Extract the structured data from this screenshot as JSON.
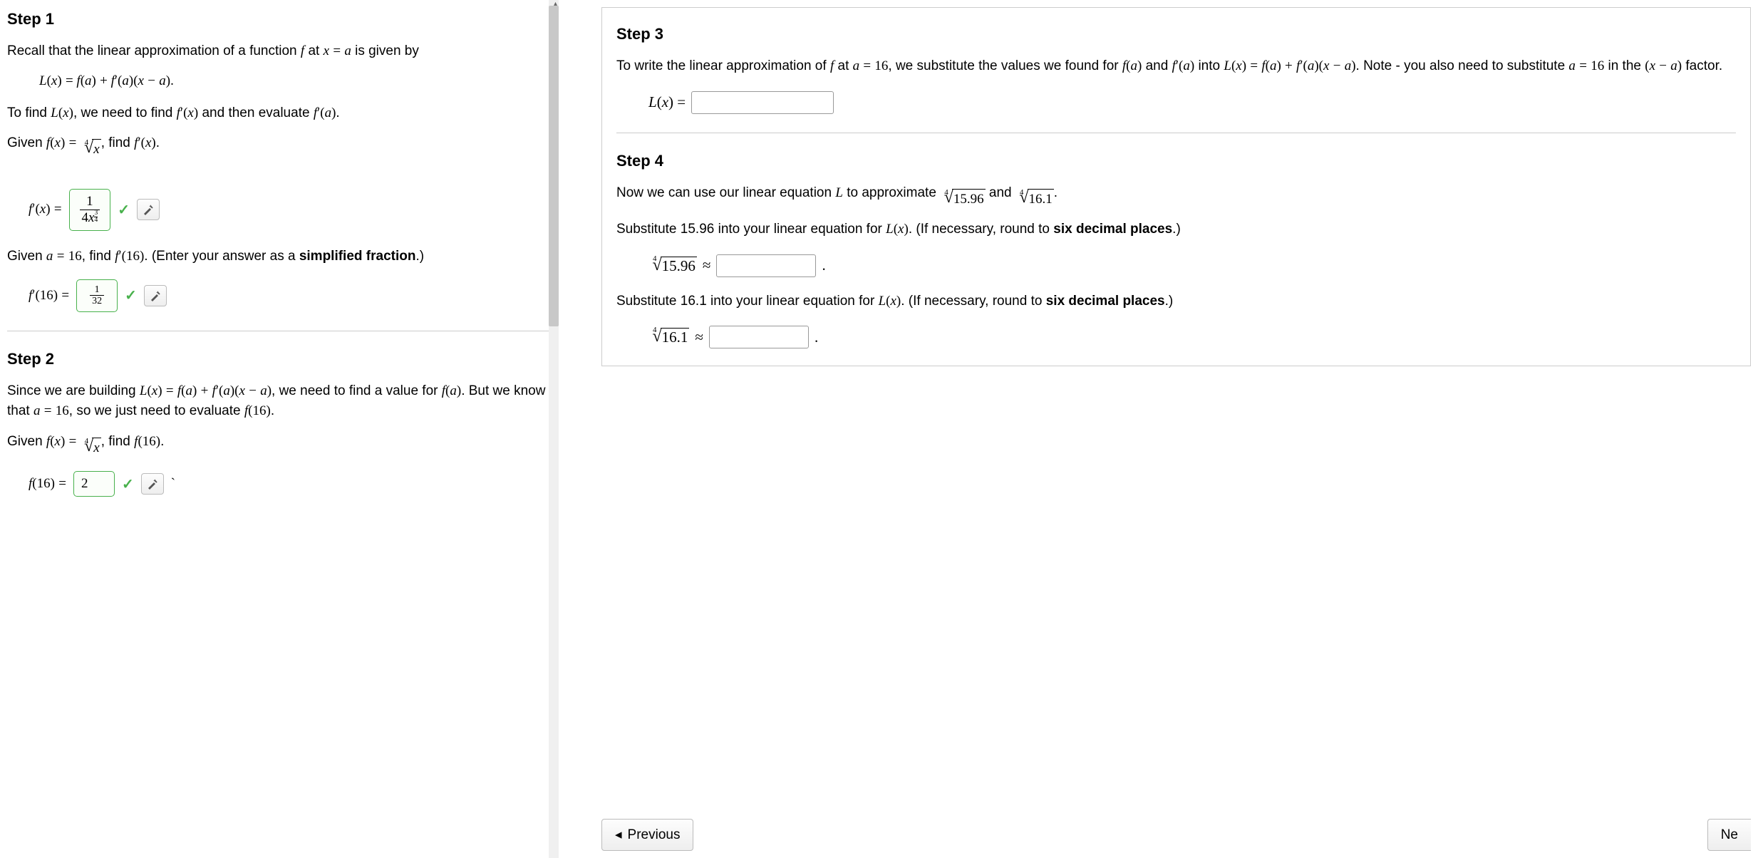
{
  "left": {
    "step1": {
      "title": "Step 1",
      "p1_pre": "Recall that the linear approximation of a function ",
      "p1_post": " is given by",
      "formula_L": "L(x) = f(a) + f′(a)(x − a).",
      "p2_a": "To find ",
      "p2_b": ", we need to find ",
      "p2_c": " and then evaluate ",
      "p2_d": ".",
      "p3_a": "Given ",
      "p3_b": ", find ",
      "p3_c": ".",
      "ans1_label_pre": "f′(x) = ",
      "ans1_num": "1",
      "ans1_den_coef": "4",
      "p4_a": "Given ",
      "p4_b": ", find ",
      "p4_c": ". (Enter your answer as a ",
      "p4_bold": "simplified fraction",
      "p4_d": ".)",
      "ans2_label": "f′(16) = ",
      "ans2_num": "1",
      "ans2_den": "32"
    },
    "step2": {
      "title": "Step 2",
      "p1_a": "Since we are building ",
      "p1_b": ", we need to find a value for ",
      "p1_c": ". But we know that ",
      "p1_d": ", so we just need to evaluate ",
      "p1_e": ".",
      "p2_a": "Given ",
      "p2_b": ", find ",
      "p2_c": ".",
      "ans3_label": "f(16) = ",
      "ans3_val": "2"
    }
  },
  "right": {
    "step3": {
      "title": "Step 3",
      "p1_a": "To write the linear approximation of ",
      "p1_b": ", we substitute the values we found for ",
      "p1_c": " and ",
      "p1_d": " into ",
      "p1_e": ". Note - you also need to substitute ",
      "p1_f": " in the ",
      "p1_g": " factor.",
      "input_label": "L(x) = "
    },
    "step4": {
      "title": "Step 4",
      "p1_a": "Now we can use our linear equation ",
      "p1_b": " to approximate ",
      "p1_c": " and ",
      "p1_d": ".",
      "p2_a": "Substitute 15.96 into your linear equation for ",
      "p2_b": ". (If necessary, round to ",
      "p2_bold": "six decimal places",
      "p2_c": ".)",
      "in2_val": "15.96",
      "p3_a": "Substitute 16.1 into your linear equation for ",
      "p3_b": ". (If necessary, round to ",
      "p3_bold": "six decimal places",
      "p3_c": ".)",
      "in3_val": "16.1",
      "period": "."
    },
    "nav": {
      "prev": "Previous",
      "next": "Ne"
    }
  }
}
